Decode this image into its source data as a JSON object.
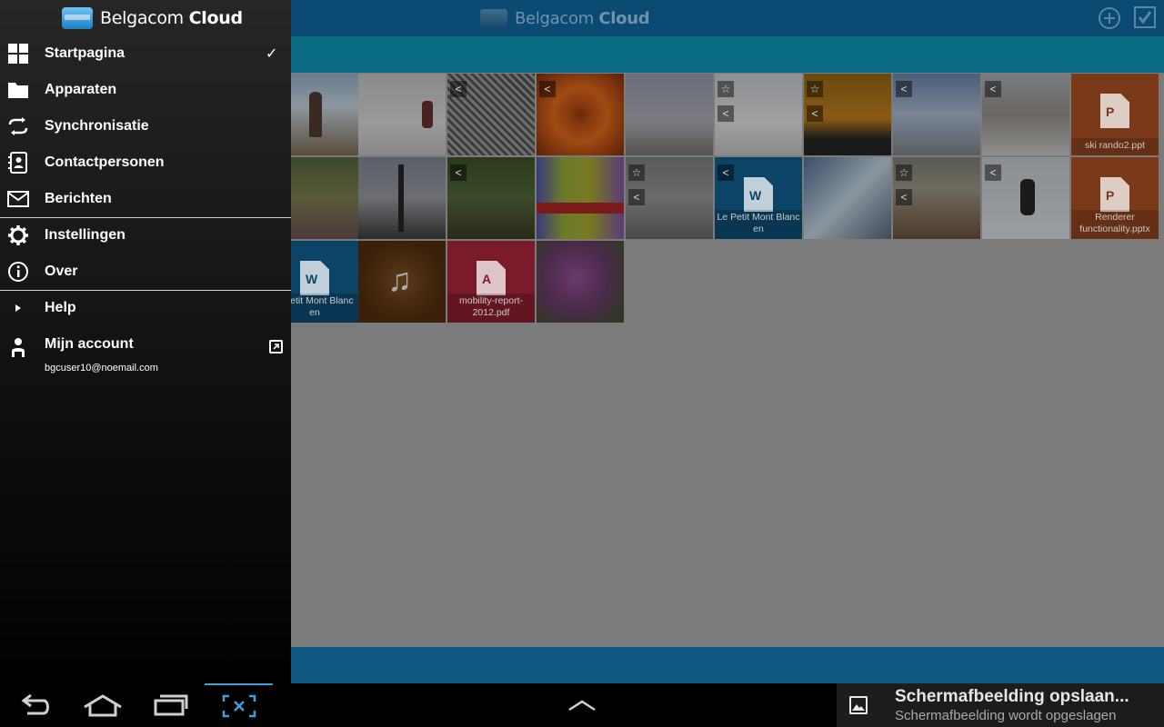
{
  "app": {
    "title_regular": "Belgacom",
    "title_bold": "Cloud"
  },
  "drawer": {
    "items": [
      {
        "label": "Startpagina",
        "icon": "grid-icon"
      },
      {
        "label": "Apparaten",
        "icon": "folder-icon"
      },
      {
        "label": "Synchronisatie",
        "icon": "sync-icon"
      },
      {
        "label": "Contactpersonen",
        "icon": "contacts-icon"
      },
      {
        "label": "Berichten",
        "icon": "mail-icon"
      },
      {
        "label": "Instellingen",
        "icon": "gear-icon"
      },
      {
        "label": "Over",
        "icon": "info-icon"
      },
      {
        "label": "Help",
        "icon": "play-icon"
      },
      {
        "label": "Mijn account",
        "icon": "person-icon"
      }
    ],
    "selected_mark": "✓",
    "account_email": "bgcuser10@noemail.com"
  },
  "tiles": [
    {
      "caption": ""
    },
    {
      "caption": ""
    },
    {
      "caption": ""
    },
    {
      "caption": ""
    },
    {
      "caption": ""
    },
    {
      "caption": ""
    },
    {
      "caption": ""
    },
    {
      "caption": ""
    },
    {
      "caption": ""
    },
    {
      "caption": "ski rando2.ppt"
    },
    {
      "caption": ""
    },
    {
      "caption": ""
    },
    {
      "caption": ""
    },
    {
      "caption": ""
    },
    {
      "caption": ""
    },
    {
      "caption": "Le Petit Mont Blanc en"
    },
    {
      "caption": ""
    },
    {
      "caption": ""
    },
    {
      "caption": ""
    },
    {
      "caption": "Renderer functionality.pptx"
    },
    {
      "caption": "e Petit Mont Blanc en"
    },
    {
      "caption": ""
    },
    {
      "caption": "mobility-report-2012.pdf"
    },
    {
      "caption": ""
    }
  ],
  "notification": {
    "title": "Schermafbeelding opslaan...",
    "subtitle": "Schermafbeelding wordt opgeslagen"
  },
  "colors": {
    "topbar": "#0b4a73",
    "subbar": "#0b6c86",
    "accent": "#3aa3d8"
  }
}
